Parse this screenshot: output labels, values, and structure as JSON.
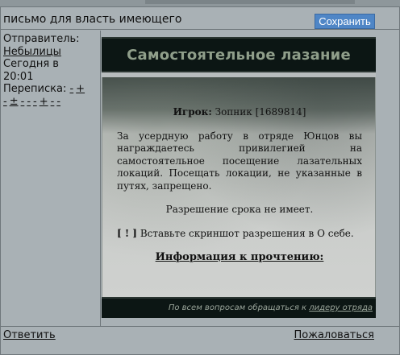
{
  "header": {
    "title": "письмо для власть имеющего",
    "save_label": "Сохранить"
  },
  "sidebar": {
    "sender_label": "Отправитель:",
    "sender_name": "Небылицы",
    "date_line_1": "Сегодня в",
    "date_line_2": "20:01",
    "correspondence_label": "Переписка:",
    "correspondence_links": [
      "-",
      "+",
      "-",
      "±",
      "-",
      "-",
      "-",
      "+",
      "-",
      "-"
    ]
  },
  "message": {
    "banner_title": "Самостоятельное лазание",
    "player_label": "Игрок:",
    "player_value": "Зопник [1689814]",
    "paragraph": "За усердную работу в отряде Юнцов вы награждаетесь привилегией на самостоятельное посещение лазательных локаций. Посещать локации, не указанные в путях, запрещено.",
    "term_note": "Разрешение срока не имеет.",
    "hint_mark": "[ ! ]",
    "hint_text": "Вставьте скриншот разрешения в О себе.",
    "info_heading": "Информация к прочтению:",
    "footer_text": "По всем вопросам обращаться к",
    "footer_link": "лидеру отряда"
  },
  "footer": {
    "reply_label": "Ответить",
    "report_label": "Пожаловаться"
  }
}
